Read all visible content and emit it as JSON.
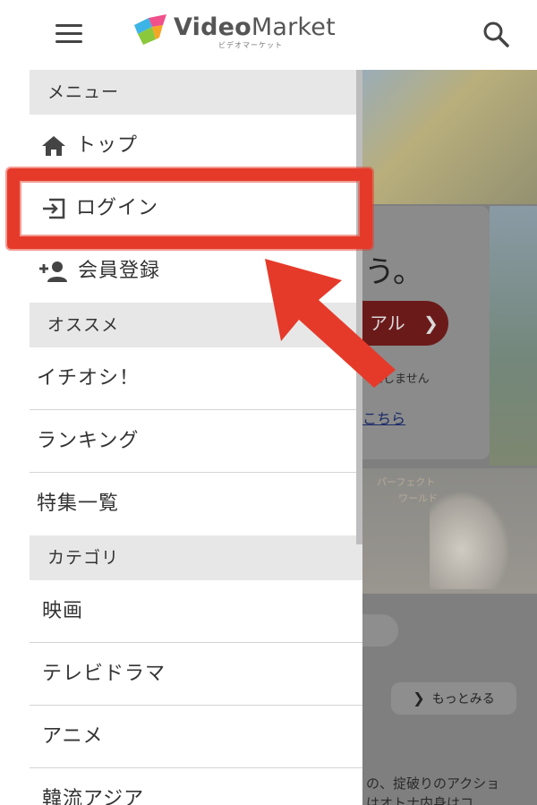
{
  "header": {
    "logo_brand_bold": "Video",
    "logo_brand_rest": "Market",
    "logo_subtitle": "ビデオマーケット",
    "icons": [
      "hamburger-menu-icon",
      "search-icon"
    ]
  },
  "menu": {
    "section_menu": "メニュー",
    "top_label": "トップ",
    "login_label": "ログイン",
    "register_label": "会員登録",
    "section_recommend": "オススメ",
    "recommend_items": [
      "イチオシ！",
      "ランキング",
      "特集一覧"
    ],
    "section_category": "カテゴリ",
    "category_items": [
      "映画",
      "テレビドラマ",
      "アニメ",
      "韓流アジア"
    ],
    "icons": [
      "home-icon",
      "login-icon",
      "add-user-icon"
    ]
  },
  "background": {
    "headline_fragment": "う。",
    "button_fragment": "アル",
    "note_fragment": "たしません",
    "link_fragment": "こちら",
    "banner_text_1": "パーフェクト",
    "banner_text_2": "ワールド",
    "more_label": "もっとみる",
    "desc_line_1": "の、掟破りのアクショ",
    "desc_line_2": "はオトナ内身はコ"
  },
  "annotation": {
    "color": "#e53a2a"
  }
}
